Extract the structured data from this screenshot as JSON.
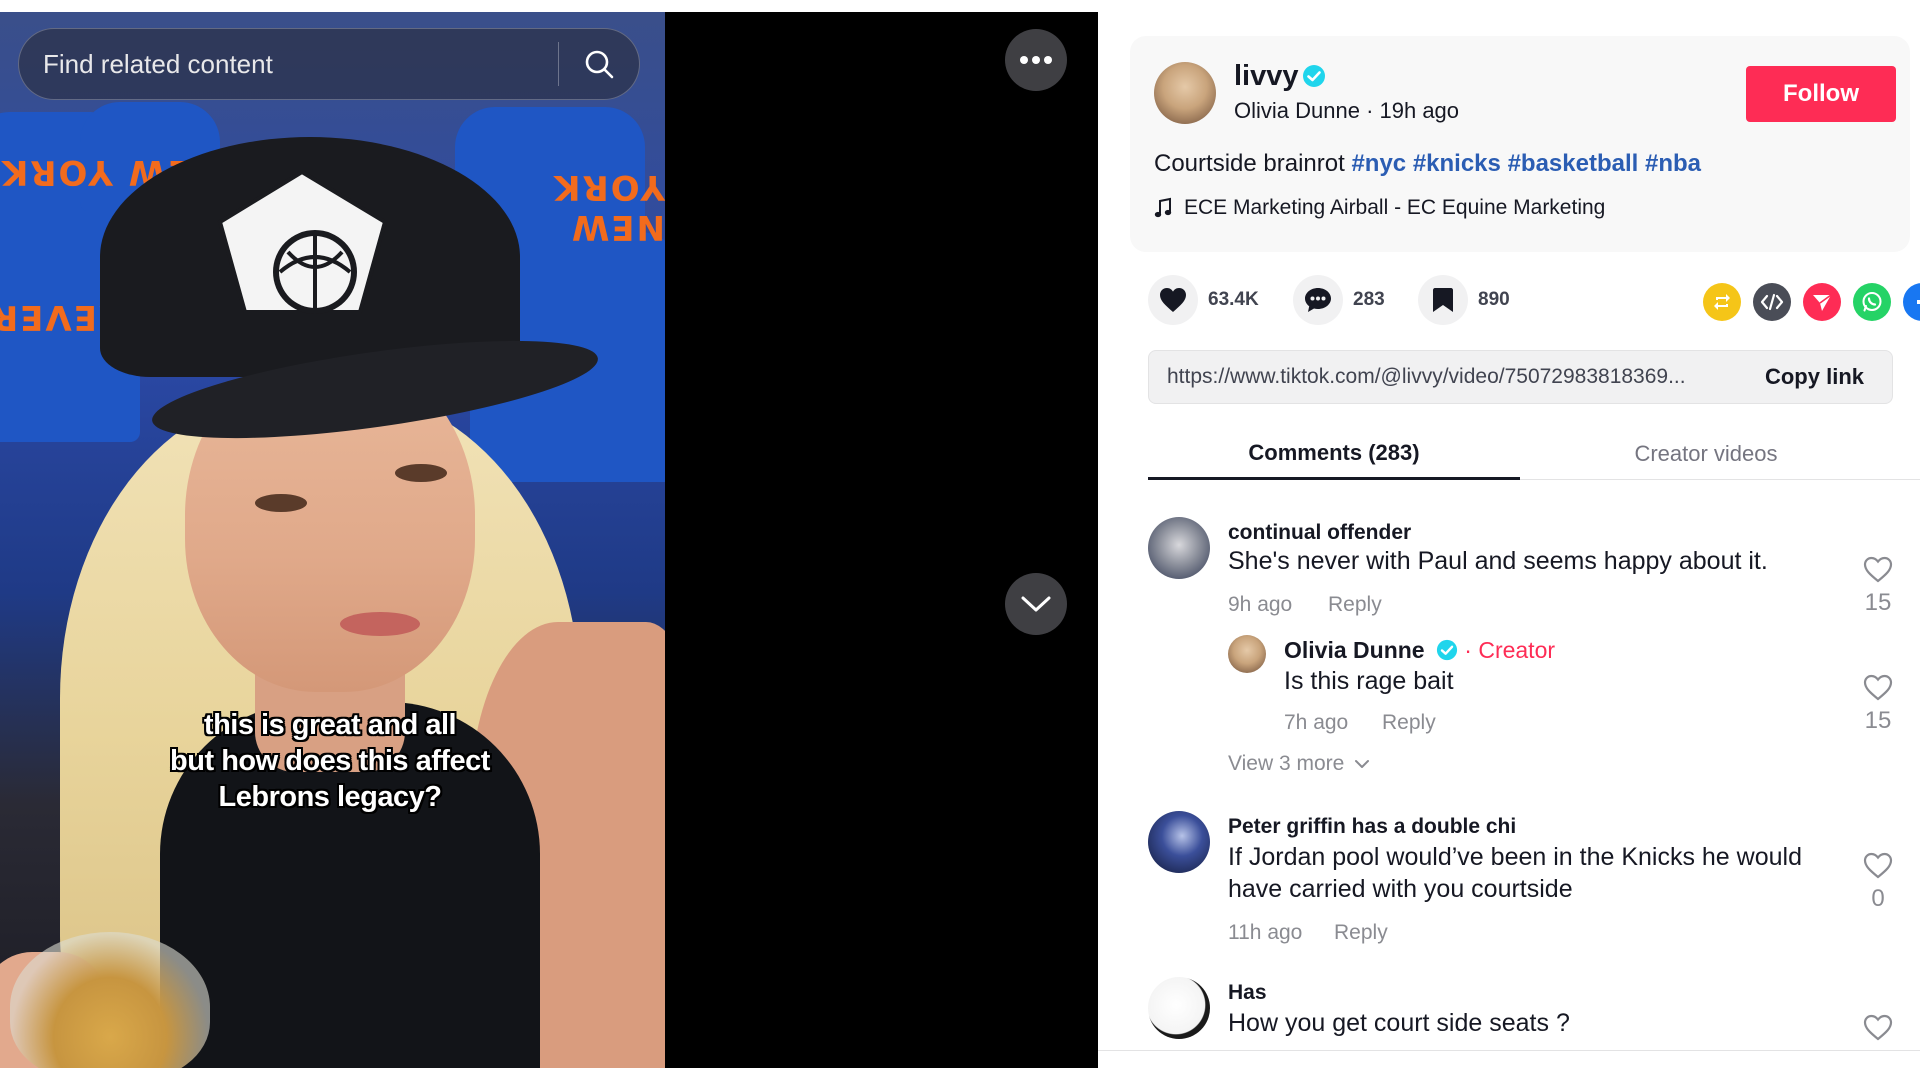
{
  "search": {
    "placeholder": "Find related content"
  },
  "video": {
    "caption_lines": [
      "this is great and all",
      "but how does this affect",
      "Lebrons legacy?"
    ]
  },
  "author": {
    "username": "livvy",
    "display_name": "Olivia Dunne",
    "posted": "19h ago",
    "sub_line": "Olivia Dunne · 19h ago",
    "follow_label": "Follow"
  },
  "post": {
    "description": "Courtside brainrot",
    "hashtags": [
      "#nyc",
      "#knicks",
      "#basketball",
      "#nba"
    ],
    "music": "ECE Marketing Airball - EC Equine Marketing"
  },
  "actions": {
    "likes": "63.4K",
    "comments": "283",
    "saves": "890"
  },
  "share_icons": [
    "repost-icon",
    "embed-icon",
    "send-icon",
    "whatsapp-icon",
    "facebook-icon",
    "share-arrow-icon"
  ],
  "share_colors": {
    "repost": "#f5c518",
    "embed": "#4a4d57",
    "send": "#fe2c55",
    "whatsapp": "#25d366",
    "facebook": "#1877f2"
  },
  "link": {
    "url": "https://www.tiktok.com/@livvy/video/75072983818369...",
    "copy_label": "Copy link"
  },
  "tabs": {
    "comments": "Comments (283)",
    "creator": "Creator videos"
  },
  "comments": [
    {
      "user": "continual offender",
      "text": "She's never with Paul and seems happy about it.",
      "time": "9h ago",
      "reply": "Reply",
      "likes": "15"
    },
    {
      "user": "Olivia Dunne",
      "creator_tag": "· Creator",
      "text": "Is this rage bait",
      "time": "7h ago",
      "reply": "Reply",
      "likes": "15"
    },
    {
      "user": "Peter griffin has a double chi",
      "text_lines": [
        "If Jordan pool would’ve been in the Knicks he would",
        "have carried with you courtside"
      ],
      "time": "11h ago",
      "reply": "Reply",
      "likes": "0"
    },
    {
      "user": "Has",
      "text": "How you get court side seats ?"
    }
  ],
  "view_more": "View 3 more",
  "accent": {
    "brand": "#fe2c55",
    "hashtag": "#2b5db3",
    "verified": "#20d5ec"
  }
}
